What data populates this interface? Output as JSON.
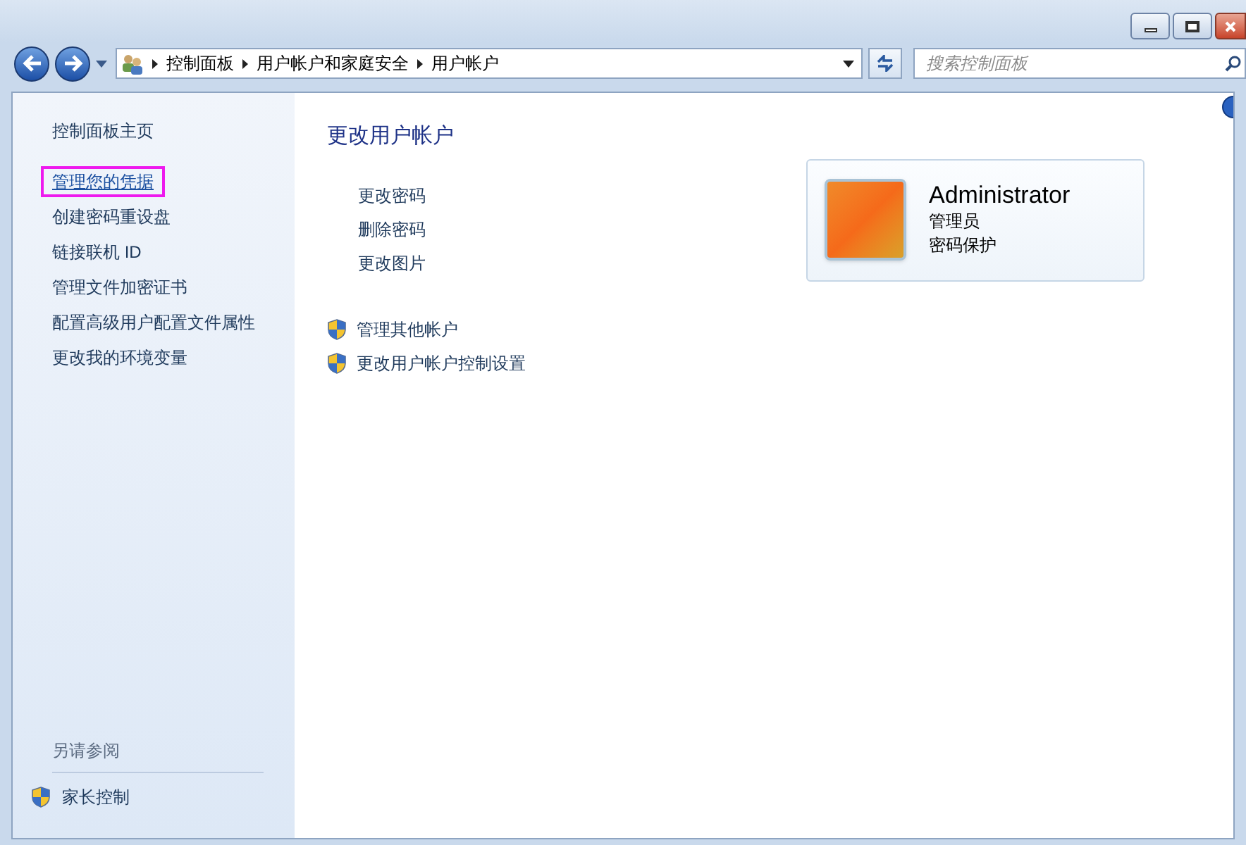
{
  "address_bar": {
    "breadcrumbs": [
      "控制面板",
      "用户帐户和家庭安全",
      "用户帐户"
    ]
  },
  "search": {
    "placeholder": "搜索控制面板"
  },
  "sidebar": {
    "items": [
      {
        "label": "控制面板主页",
        "highlighted": false,
        "kind": "heading"
      },
      {
        "label": "管理您的凭据",
        "highlighted": true,
        "kind": "link"
      },
      {
        "label": "创建密码重设盘",
        "highlighted": false,
        "kind": "link"
      },
      {
        "label": "链接联机 ID",
        "highlighted": false,
        "kind": "link"
      },
      {
        "label": "管理文件加密证书",
        "highlighted": false,
        "kind": "link"
      },
      {
        "label": "配置高级用户配置文件属性",
        "highlighted": false,
        "kind": "link"
      },
      {
        "label": "更改我的环境变量",
        "highlighted": false,
        "kind": "link"
      }
    ],
    "see_also": {
      "title": "另请参阅",
      "items": [
        "家长控制"
      ]
    }
  },
  "main": {
    "title": "更改用户帐户",
    "links": [
      {
        "label": "更改密码"
      },
      {
        "label": "删除密码"
      },
      {
        "label": "更改图片"
      }
    ],
    "other_links": [
      {
        "label": "管理其他帐户",
        "kind": "shield"
      },
      {
        "label": "更改用户帐户控制设置",
        "kind": "shield"
      }
    ],
    "account": {
      "name": "Administrator",
      "role": "管理员",
      "status": "密码保护"
    }
  }
}
